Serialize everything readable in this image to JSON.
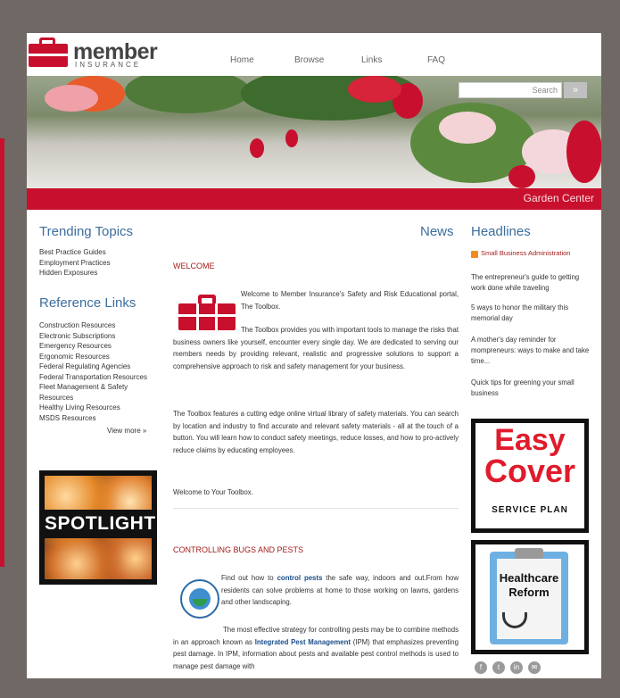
{
  "header": {
    "logo_word": "member",
    "logo_sub": "INSURANCE",
    "nav": [
      "Home",
      "Browse",
      "Links",
      "FAQ"
    ]
  },
  "search": {
    "placeholder": "Search",
    "button_label": "»"
  },
  "hero": {
    "caption": "Garden Center"
  },
  "left": {
    "trending_title": "Trending Topics",
    "trending_items": [
      "Best Practice Guides",
      "Employment Practices",
      "Hidden Exposures"
    ],
    "reference_title": "Reference Links",
    "reference_items": [
      "Construction Resources",
      "Electronic Subscriptions",
      "Emergency Resources",
      "Ergonomic Resources",
      "Federal Regulating Agencies",
      "Federal Transportation Resources",
      "Fleet Management & Safety",
      "Resources",
      "Healthy Living Resources",
      "MSDS Resources"
    ],
    "view_more": "View more »",
    "spotlight_label": "SPOTLIGHT"
  },
  "center": {
    "news_title": "News",
    "welcome_title": "WELCOME",
    "welcome_p1": "Welcome to Member Insurance's Safety and Risk Educational portal, The Toolbox.",
    "welcome_p2": "The Toolbox provides you with important tools to manage the risks that business owners like yourself, encounter every single day. We are dedicated to serving our members needs by providing relevant, realistic and progressive solutions to support a comprehensive approach to risk and safety management for your business.",
    "welcome_p3": "The Toolbox features a cutting edge online virtual library of safety materials. You can search by location and industry to find accurate and relevant safety materials - all at the touch of a button. You will learn how to conduct safety meetings, reduce losses, and how to pro-actively reduce claims by educating employees.",
    "welcome_p4": "Welcome to Your Toolbox.",
    "bugs_title": "CONTROLLING BUGS AND PESTS",
    "bugs_p1_a": "Find out how to",
    "bugs_p1_link": "control pests",
    "bugs_p1_b": "the safe way, indoors and out.From how residents can solve problems at home to those working on lawns, gardens and other landscaping.",
    "bugs_p2_a": "The most effective strategy for controlling pests may be to combine methods in an approach known as",
    "bugs_p2_link": "Integrated Pest Management",
    "bugs_p2_b": "(IPM) that emphasizes preventing pest damage. In IPM, information about pests and available pest control methods is used to manage pest damage with"
  },
  "right": {
    "headlines_title": "Headlines",
    "feed_label": "Small Business Administration",
    "headlines": [
      "The entrepreneur's guide to getting work done while traveling",
      "5 ways to honor the military this memorial day",
      "A mother's day reminder for mompreneurs: ways to make and take time...",
      "Quick tips for greening your small business"
    ],
    "easy_word": "Easy",
    "cover_word": "Cover",
    "service_plan": "SERVICE PLAN",
    "healthcare_text": "Healthcare Reform",
    "social_icons": [
      "facebook-icon",
      "twitter-icon",
      "linkedin-icon",
      "email-icon"
    ]
  },
  "colors": {
    "brand_red": "#c8102e",
    "heading_blue": "#3c6e9e",
    "frame_gray": "#6f6864"
  }
}
